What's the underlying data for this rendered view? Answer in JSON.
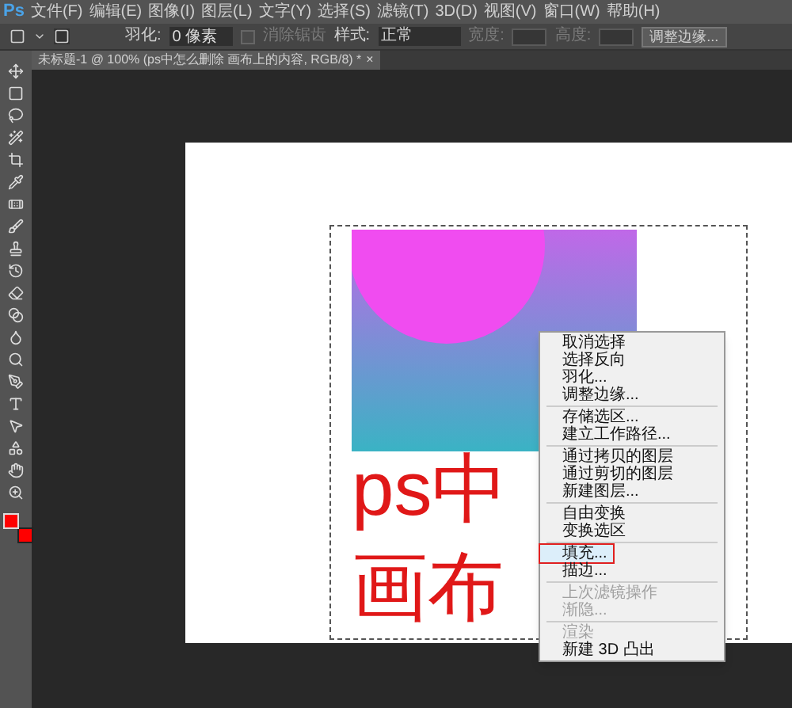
{
  "app": {
    "logo": "Ps"
  },
  "menu_bar": [
    "文件(F)",
    "编辑(E)",
    "图像(I)",
    "图层(L)",
    "文字(Y)",
    "选择(S)",
    "滤镜(T)",
    "3D(D)",
    "视图(V)",
    "窗口(W)",
    "帮助(H)"
  ],
  "options_bar": {
    "feather_label": "羽化:",
    "feather_value": "0 像素",
    "antialias": {
      "label": "消除锯齿",
      "disabled": true
    },
    "style_label": "样式:",
    "style_value": "正常",
    "width_label": "宽度:",
    "height_label": "高度:",
    "refine_button": "调整边缘..."
  },
  "document_tab": {
    "title": "未标题-1 @ 100% (ps中怎么删除 画布上的内容, RGB/8) *",
    "close": "×",
    "selected": true
  },
  "canvas": {
    "lines": [
      "ps中",
      "画布"
    ]
  },
  "context_menu": {
    "groups": [
      [
        {
          "label": "取消选择",
          "disabled": false,
          "selected": false
        },
        {
          "label": "选择反向",
          "disabled": false,
          "selected": false
        },
        {
          "label": "羽化...",
          "disabled": false,
          "selected": false
        },
        {
          "label": "调整边缘...",
          "disabled": false,
          "selected": false
        }
      ],
      [
        {
          "label": "存储选区...",
          "disabled": false,
          "selected": false
        },
        {
          "label": "建立工作路径...",
          "disabled": false,
          "selected": false
        }
      ],
      [
        {
          "label": "通过拷贝的图层",
          "disabled": false,
          "selected": false
        },
        {
          "label": "通过剪切的图层",
          "disabled": false,
          "selected": false
        },
        {
          "label": "新建图层...",
          "disabled": false,
          "selected": false
        }
      ],
      [
        {
          "label": "自由变换",
          "disabled": false,
          "selected": false
        },
        {
          "label": "变换选区",
          "disabled": false,
          "selected": false
        }
      ],
      [
        {
          "label": "填充...",
          "disabled": false,
          "selected": true
        },
        {
          "label": "描边...",
          "disabled": false,
          "selected": false
        }
      ],
      [
        {
          "label": "上次滤镜操作",
          "disabled": true,
          "selected": false
        },
        {
          "label": "渐隐...",
          "disabled": true,
          "selected": false
        }
      ],
      [
        {
          "label": "渲染",
          "disabled": true,
          "selected": false
        },
        {
          "label": "新建 3D 凸出",
          "disabled": false,
          "selected": false
        }
      ]
    ]
  }
}
